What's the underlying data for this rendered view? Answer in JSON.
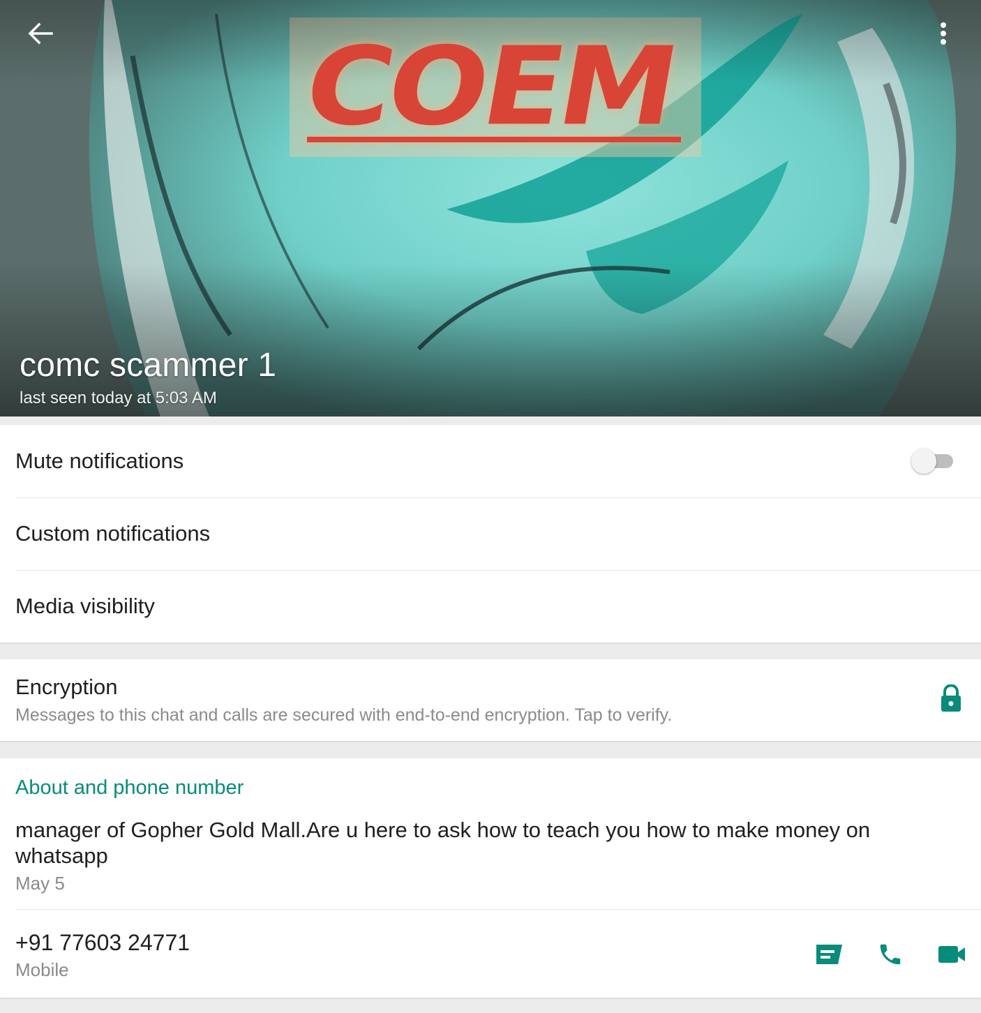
{
  "header": {
    "contact_name": "comc scammer 1",
    "last_seen": "last seen today at 5:03 AM",
    "cover_logo_text": "COEM",
    "back_icon": "arrow-left-icon",
    "menu_icon": "more-vert-icon"
  },
  "settings": {
    "mute_label": "Mute notifications",
    "mute_enabled": false,
    "custom_label": "Custom notifications",
    "media_label": "Media visibility"
  },
  "encryption": {
    "title": "Encryption",
    "description": "Messages to this chat and calls are secured with end-to-end encryption. Tap to verify.",
    "icon": "lock-icon"
  },
  "about": {
    "section_title": "About and phone number",
    "status_text": "manager of Gopher Gold Mall.Are u here to ask how to teach you how to make money on whatsapp",
    "status_date": "May 5",
    "phone_number": "+91 77603 24771",
    "phone_type": "Mobile",
    "actions": [
      "message-icon",
      "phone-icon",
      "video-call-icon"
    ]
  },
  "colors": {
    "accent": "#078b7b",
    "logo_red": "#d84436",
    "secondary_text": "#8a8a8a"
  }
}
